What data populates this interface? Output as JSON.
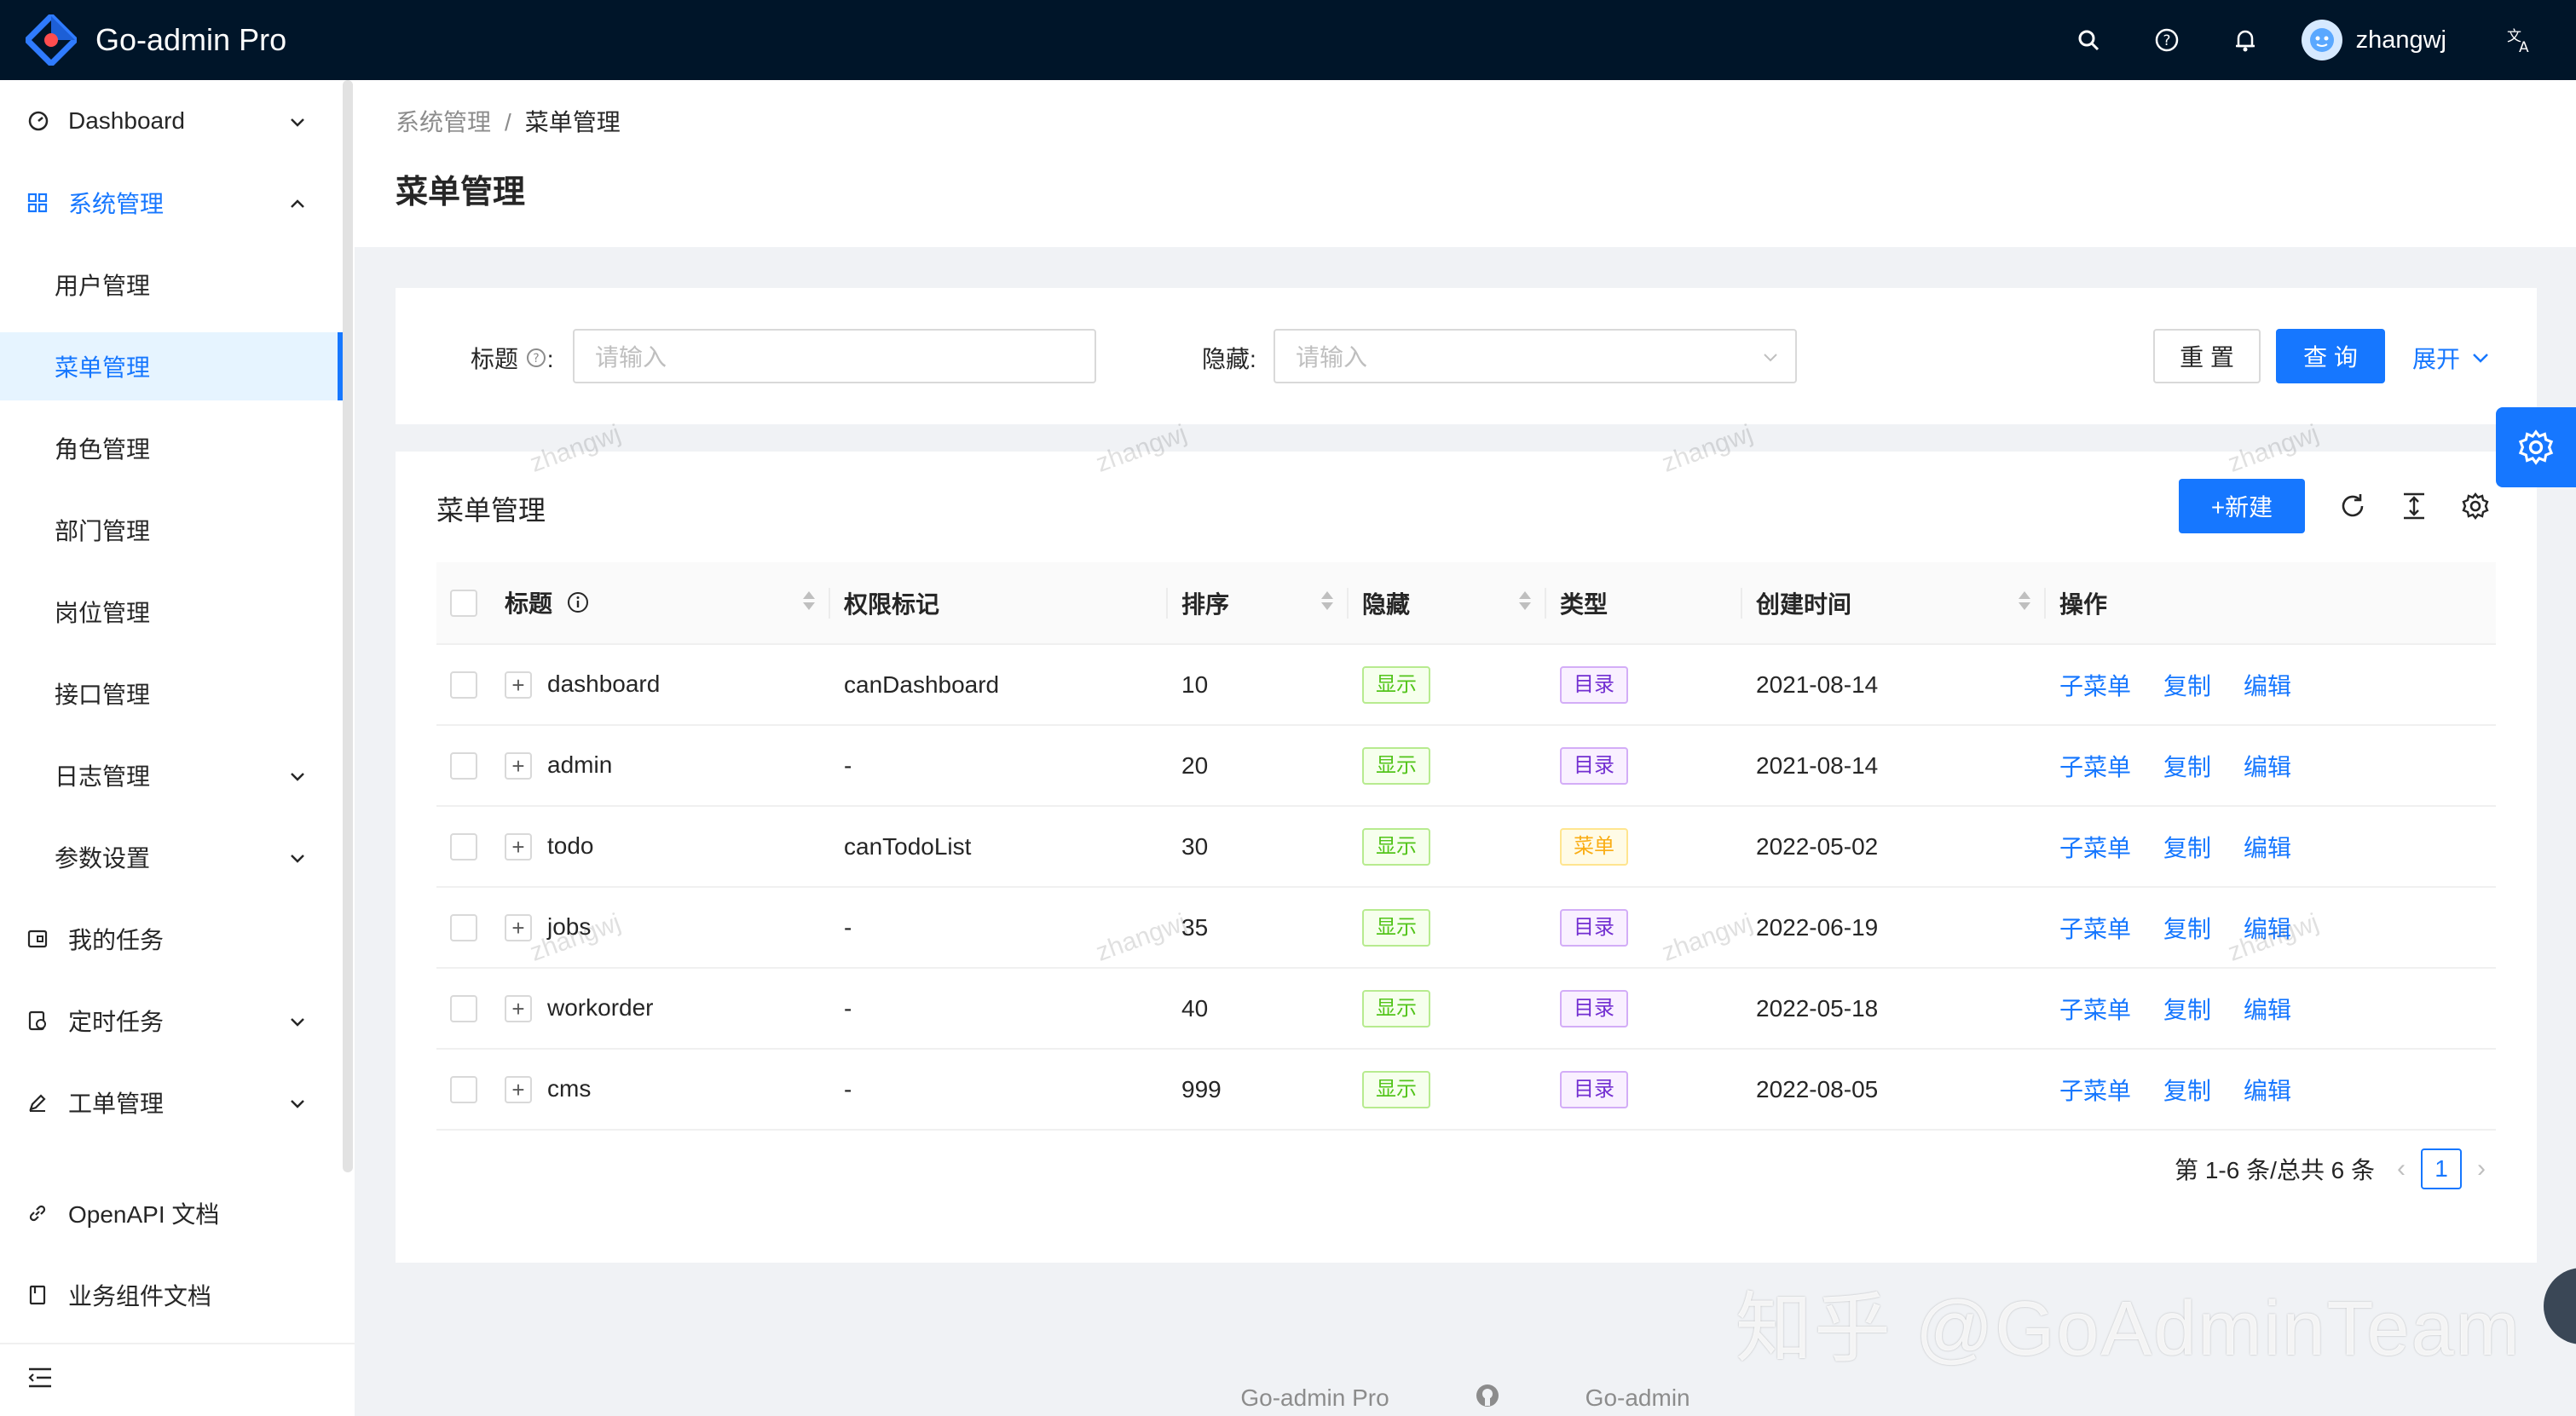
{
  "app": {
    "title": "Go-admin Pro"
  },
  "header": {
    "username": "zhangwj"
  },
  "sidebar": {
    "items": [
      {
        "label": "Dashboard"
      },
      {
        "label": "系统管理"
      },
      {
        "label": "用户管理"
      },
      {
        "label": "菜单管理"
      },
      {
        "label": "角色管理"
      },
      {
        "label": "部门管理"
      },
      {
        "label": "岗位管理"
      },
      {
        "label": "接口管理"
      },
      {
        "label": "日志管理"
      },
      {
        "label": "参数设置"
      },
      {
        "label": "我的任务"
      },
      {
        "label": "定时任务"
      },
      {
        "label": "工单管理"
      },
      {
        "label": "OpenAPI 文档"
      },
      {
        "label": "业务组件文档"
      }
    ]
  },
  "breadcrumb": {
    "parent": "系统管理",
    "separator": "/",
    "current": "菜单管理"
  },
  "page": {
    "title": "菜单管理"
  },
  "search": {
    "title_label": "标题",
    "title_placeholder": "请输入",
    "hidden_label": "隐藏",
    "hidden_placeholder": "请输入",
    "reset_label": "重 置",
    "query_label": "查 询",
    "expand_label": "展开"
  },
  "table": {
    "card_title": "菜单管理",
    "new_label": "+新建",
    "columns": [
      "标题",
      "权限标记",
      "排序",
      "隐藏",
      "类型",
      "创建时间",
      "操作"
    ],
    "rows": [
      {
        "title": "dashboard",
        "perm": "canDashboard",
        "sort": "10",
        "hidden": "显示",
        "type": "目录",
        "created": "2021-08-14"
      },
      {
        "title": "admin",
        "perm": "-",
        "sort": "20",
        "hidden": "显示",
        "type": "目录",
        "created": "2021-08-14"
      },
      {
        "title": "todo",
        "perm": "canTodoList",
        "sort": "30",
        "hidden": "显示",
        "type": "菜单",
        "created": "2022-05-02"
      },
      {
        "title": "jobs",
        "perm": "-",
        "sort": "35",
        "hidden": "显示",
        "type": "目录",
        "created": "2022-06-19"
      },
      {
        "title": "workorder",
        "perm": "-",
        "sort": "40",
        "hidden": "显示",
        "type": "目录",
        "created": "2022-05-18"
      },
      {
        "title": "cms",
        "perm": "-",
        "sort": "999",
        "hidden": "显示",
        "type": "目录",
        "created": "2022-08-05"
      }
    ],
    "actions": {
      "sub": "子菜单",
      "copy": "复制",
      "edit": "编辑"
    }
  },
  "pagination": {
    "summary": "第 1-6 条/总共 6 条",
    "current": "1"
  },
  "watermark": "zhangwj",
  "overlay": "知乎 @GoAdminTeam",
  "footer": {
    "left": "Go-admin Pro",
    "right": "Go-admin"
  },
  "colors": {
    "primary": "#1677ff",
    "header_bg": "#001529",
    "tag_green": "#52c41a",
    "tag_purple": "#722ed1",
    "tag_gold": "#faad14"
  }
}
